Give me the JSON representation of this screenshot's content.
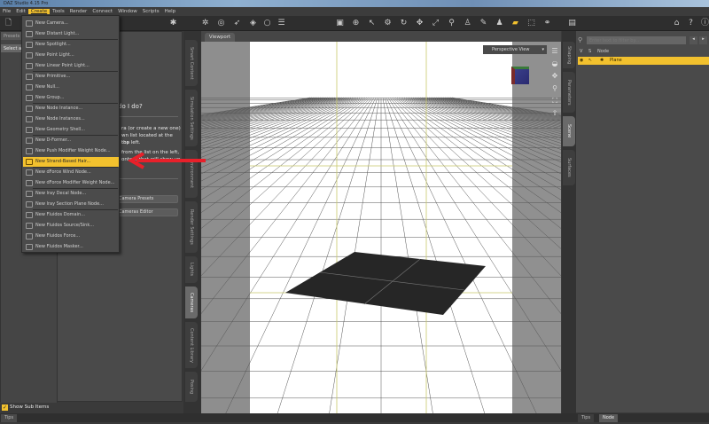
{
  "window": {
    "title": "DAZ Studio 4.15 Pro"
  },
  "menubar": [
    "File",
    "Edit",
    "Create",
    "Tools",
    "Render",
    "Connect",
    "Window",
    "Scripts",
    "Help"
  ],
  "active_menu": "Create",
  "create_menu": {
    "items": [
      {
        "label": "New Camera...",
        "icon": "camera-icon"
      },
      {
        "label": "New Distant Light...",
        "icon": "distant-light-icon"
      },
      {
        "label": "New Spotlight...",
        "icon": "spotlight-icon"
      },
      {
        "label": "New Point Light...",
        "icon": "point-light-icon"
      },
      {
        "label": "New Linear Point Light...",
        "icon": "linear-point-light-icon"
      },
      {
        "label": "New Primitive...",
        "icon": "primitive-icon"
      },
      {
        "label": "New Null...",
        "icon": "null-icon"
      },
      {
        "label": "New Group...",
        "icon": "group-icon"
      },
      {
        "label": "New Node Instance...",
        "icon": "node-instance-icon"
      },
      {
        "label": "New Node Instances...",
        "icon": "node-instances-icon"
      },
      {
        "label": "New Geometry Shell...",
        "icon": "geometry-shell-icon"
      },
      {
        "label": "New D-Former...",
        "icon": "dformer-icon"
      },
      {
        "label": "New Push Modifier Weight Node...",
        "icon": "push-modifier-icon"
      },
      {
        "label": "New Strand-Based Hair...",
        "icon": "hair-icon",
        "highlighted": true
      },
      {
        "label": "New dForce Wind Node...",
        "icon": "wind-icon"
      },
      {
        "label": "New dForce Modifier Weight Node...",
        "icon": "dforce-modifier-icon"
      },
      {
        "label": "New Iray Decal Node...",
        "icon": "decal-icon"
      },
      {
        "label": "New Iray Section Plane Node...",
        "icon": "section-plane-icon"
      },
      {
        "label": "New Fluidos Domain...",
        "icon": "fluidos-domain-icon"
      },
      {
        "label": "New Fluidos Source/Sink...",
        "icon": "fluidos-source-icon"
      },
      {
        "label": "New Fluidos Force...",
        "icon": "fluidos-force-icon"
      },
      {
        "label": "New Fluidos Masker...",
        "icon": "fluidos-masker-icon"
      }
    ]
  },
  "left_panel": {
    "tab": "Presets",
    "select_label": "Select an...",
    "heading": "do I do?",
    "text1": "ra (or create a new one)",
    "text2": "wn list located at the top",
    "text3": "the left.",
    "text4": "from the list on the left,",
    "text5": "ontent that will show up",
    "button1": "Camera Presets",
    "button2": "Cameras Editor",
    "show_sub_items": "Show Sub Items",
    "show_sub_items_checked": true
  },
  "left_tabs": [
    "Smart Content",
    "Simulation Settings",
    "Environment",
    "Render Settings",
    "Lights",
    "Cameras",
    "Content Library",
    "Posing"
  ],
  "left_tabs_selected": "Cameras",
  "viewport": {
    "tab": "Viewport",
    "view": "Perspective View"
  },
  "right_tabs": [
    "Shaping",
    "Parameters",
    "Scene",
    "Surfaces"
  ],
  "right_tabs_selected": "Scene",
  "scene": {
    "search_placeholder": "Enter text to filter by...",
    "col_v": "V",
    "col_s": "S",
    "col_node": "Node",
    "rows": [
      {
        "label": "Plane",
        "selected": true
      }
    ]
  },
  "bottom_tabs_left": [
    "Tips"
  ],
  "bottom_tabs_right": [
    "Tips",
    "Node"
  ],
  "colors": {
    "highlight": "#f2c12e",
    "arrow": "#e8202a",
    "axis": "#c8c86a"
  }
}
